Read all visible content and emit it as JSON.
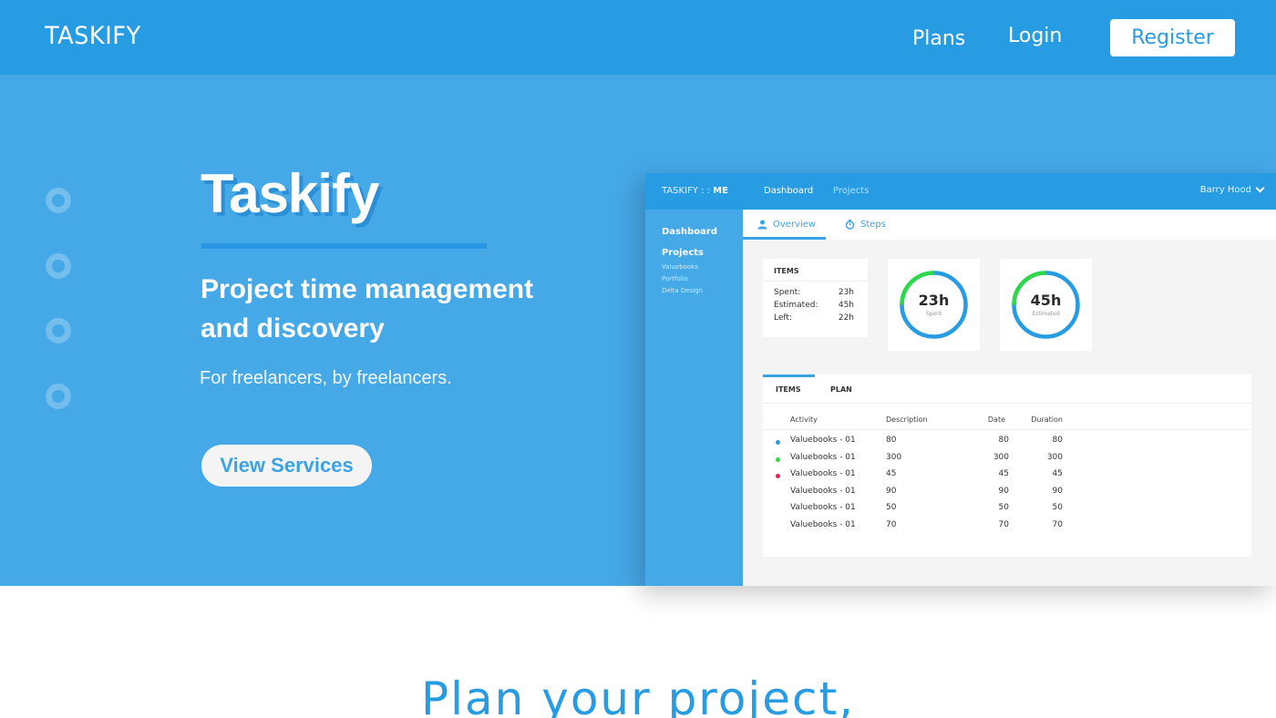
{
  "nav": {
    "brand": "TASKIFY",
    "links": [
      "Plans",
      "Login"
    ],
    "register_label": "Register"
  },
  "hero": {
    "title": "Taskify",
    "subtitle": "Project time management and discovery",
    "tagline": "For freelancers, by freelancers.",
    "cta_label": "View Services",
    "slide_count": 4
  },
  "app": {
    "brand_prefix": "TASKIFY : : ",
    "brand_suffix": "ME",
    "top_tabs": [
      "Dashboard",
      "Projects"
    ],
    "user_name": "Barry Hood",
    "sidebar": {
      "main_items": [
        "Dashboard",
        "Projects"
      ],
      "sub_items": [
        "Valuebooks",
        "Portfolio",
        "Delta Design"
      ]
    },
    "subtabs": [
      {
        "label": "Overview",
        "icon": "user-icon",
        "active": true
      },
      {
        "label": "Steps",
        "icon": "stopwatch-icon",
        "active": false
      }
    ],
    "items_card": {
      "header": "ITEMS",
      "rows": [
        {
          "key": "Spent:",
          "value": "23h"
        },
        {
          "key": "Estimated:",
          "value": "45h"
        },
        {
          "key": "Left:",
          "value": "22h"
        }
      ]
    },
    "rings": [
      {
        "value": "23h",
        "label": "Spent",
        "progress": 0.25
      },
      {
        "value": "45h",
        "label": "Estimated",
        "progress": 0.25
      }
    ],
    "colors": {
      "ring_progress": "#2ed848",
      "ring_track": "#279ce3",
      "accent": "#279ce3"
    },
    "table": {
      "tabs": [
        "ITEMS",
        "PLAN"
      ],
      "columns": [
        "Activity",
        "Description",
        "Date",
        "Duration"
      ],
      "rows": [
        {
          "dot": "#279ce3",
          "activity": "Valuebooks - 01",
          "description": "80",
          "date": "80",
          "duration": "80"
        },
        {
          "dot": "#2ed848",
          "activity": "Valuebooks - 01",
          "description": "300",
          "date": "300",
          "duration": "300"
        },
        {
          "dot": "#e8204d",
          "activity": "Valuebooks - 01",
          "description": "45",
          "date": "45",
          "duration": "45"
        },
        {
          "dot": "",
          "activity": "Valuebooks - 01",
          "description": "90",
          "date": "90",
          "duration": "90"
        },
        {
          "dot": "",
          "activity": "Valuebooks - 01",
          "description": "50",
          "date": "50",
          "duration": "50"
        },
        {
          "dot": "",
          "activity": "Valuebooks - 01",
          "description": "70",
          "date": "70",
          "duration": "70"
        }
      ]
    }
  },
  "section": {
    "title": "Plan your project,"
  }
}
